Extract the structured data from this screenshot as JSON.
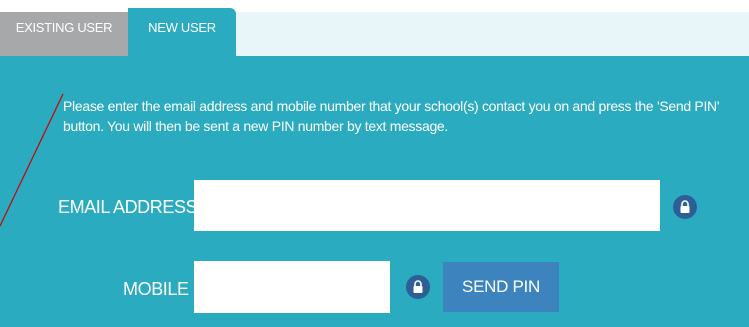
{
  "tabs": [
    {
      "label": "EXISTING USER",
      "active": false
    },
    {
      "label": "NEW USER",
      "active": true
    }
  ],
  "instructions": "Please enter the email address and mobile number that your school(s) contact you on and press the 'Send PIN' button. You will then be sent a new PIN number by text message.",
  "form": {
    "email_label": "EMAIL ADDRESS",
    "email_value": "",
    "mobile_label": "MOBILE",
    "mobile_value": "",
    "send_button_label": "SEND PIN"
  },
  "icons": {
    "email_lock": "lock-icon",
    "mobile_lock": "lock-icon"
  },
  "colors": {
    "panel": "#2aabbf",
    "inactive_tab": "#a7a8a9",
    "button": "#3d84be",
    "lock_badge": "#2d5f96",
    "annotation_line": "#cc0000"
  }
}
